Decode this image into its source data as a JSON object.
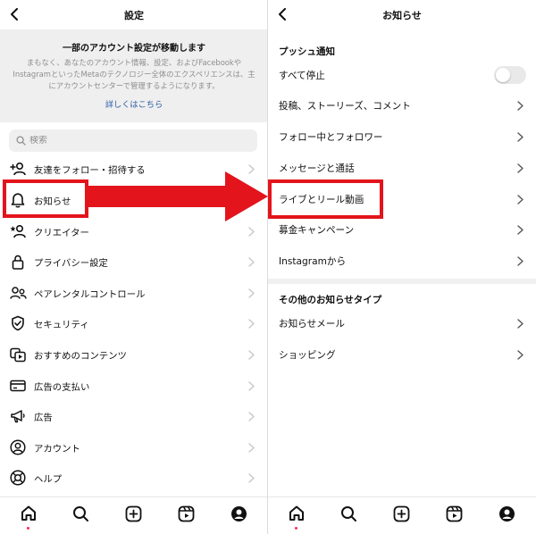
{
  "left": {
    "header_title": "設定",
    "notice": {
      "title": "一部のアカウント設定が移動します",
      "body": "まもなく、あなたのアカウント情報、設定、およびFacebookやInstagramといったMetaのテクノロジー全体のエクスペリエンスは、主にアカウントセンターで管理するようになります。",
      "link": "詳しくはこちら"
    },
    "search_placeholder": "検索",
    "items": [
      {
        "label": "友達をフォロー・招待する",
        "icon": "add-person-icon"
      },
      {
        "label": "お知らせ",
        "icon": "bell-icon"
      },
      {
        "label": "クリエイター",
        "icon": "creator-icon"
      },
      {
        "label": "プライバシー設定",
        "icon": "lock-icon"
      },
      {
        "label": "ペアレンタルコントロール",
        "icon": "family-icon"
      },
      {
        "label": "セキュリティ",
        "icon": "shield-icon"
      },
      {
        "label": "おすすめのコンテンツ",
        "icon": "suggested-content-icon"
      },
      {
        "label": "広告の支払い",
        "icon": "card-icon"
      },
      {
        "label": "広告",
        "icon": "megaphone-icon"
      },
      {
        "label": "アカウント",
        "icon": "account-icon"
      },
      {
        "label": "ヘルプ",
        "icon": "help-lifebuoy-icon"
      }
    ]
  },
  "right": {
    "header_title": "お知らせ",
    "push_section": "プッシュ通知",
    "pause_all": "すべて停止",
    "pause_all_on": false,
    "push_items": [
      {
        "label": "投稿、ストーリーズ、コメント"
      },
      {
        "label": "フォロー中とフォロワー"
      },
      {
        "label": "メッセージと通話"
      },
      {
        "label": "ライブとリール動画"
      },
      {
        "label": "募金キャンペーン"
      },
      {
        "label": "Instagramから"
      }
    ],
    "other_section": "その他のお知らせタイプ",
    "other_items": [
      {
        "label": "お知らせメール"
      },
      {
        "label": "ショッピング"
      }
    ]
  },
  "tabbar": {
    "tabs": [
      "home-icon",
      "search-icon",
      "create-icon",
      "reels-icon",
      "profile-icon"
    ],
    "active_tab": "home-icon"
  },
  "annotations": {
    "highlight_color": "#e3141c"
  }
}
